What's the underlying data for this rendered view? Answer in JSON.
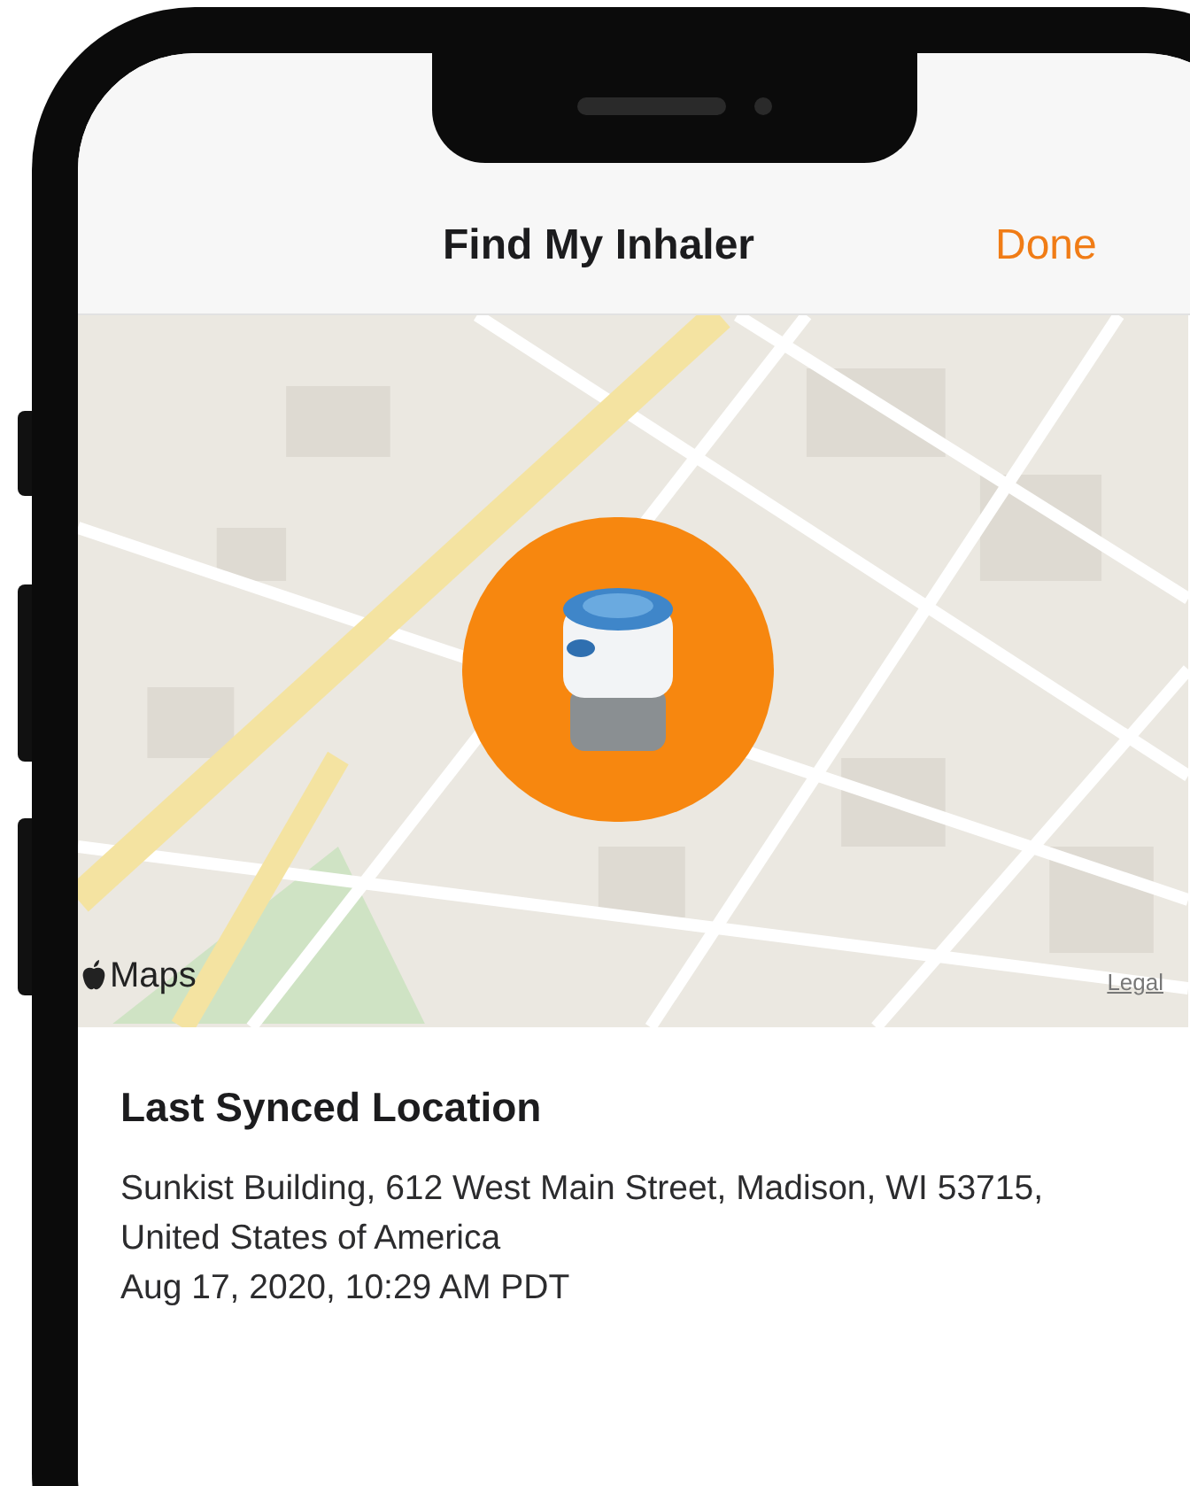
{
  "header": {
    "title": "Find My Inhaler",
    "done": "Done"
  },
  "map": {
    "attribution": "Maps",
    "legal": "Legal"
  },
  "location": {
    "heading": "Last Synced Location",
    "address": "Sunkist Building, 612 West Main Street, Madison, WI 53715, United States of America",
    "timestamp": "Aug 17, 2020, 10:29 AM PDT"
  }
}
